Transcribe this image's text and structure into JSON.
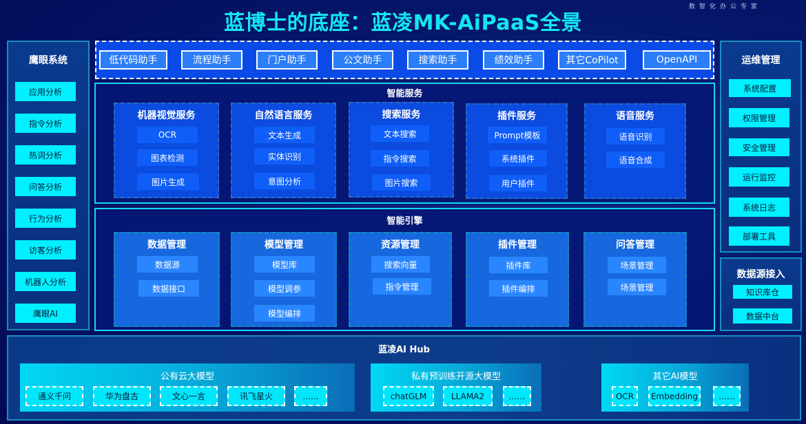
{
  "header": {
    "title": "蓝博士的底座：蓝凌MK-AiPaaS全景",
    "brand": "数智化办公专家"
  },
  "left_panel": {
    "title": "鹰眼系统",
    "items": [
      "应用分析",
      "指令分析",
      "热词分析",
      "问答分析",
      "行为分析",
      "访客分析",
      "机器人分析",
      "鹰眼AI"
    ]
  },
  "copilot_bar": {
    "items": [
      "低代码助手",
      "流程助手",
      "门户助手",
      "公文助手",
      "搜索助手",
      "绩效助手",
      "其它CoPilot",
      "OpenAPI"
    ]
  },
  "smart_services": {
    "title": "智能服务",
    "groups": [
      {
        "title": "机器视觉服务",
        "items": [
          "OCR",
          "图表检测",
          "图片生成"
        ]
      },
      {
        "title": "自然语言服务",
        "items": [
          "文本生成",
          "实体识别",
          "意图分析"
        ]
      },
      {
        "title": "搜索服务",
        "items": [
          "文本搜索",
          "指令搜索",
          "图片搜索"
        ]
      },
      {
        "title": "插件服务",
        "items": [
          "Prompt模板",
          "系统插件",
          "用户插件"
        ]
      },
      {
        "title": "语音服务",
        "items": [
          "语音识别",
          "语音合成"
        ]
      }
    ]
  },
  "smart_engine": {
    "title": "智能引擎",
    "groups": [
      {
        "title": "数据管理",
        "items": [
          "数据源",
          "数据接口"
        ]
      },
      {
        "title": "模型管理",
        "items": [
          "模型库",
          "模型调参",
          "模型编排"
        ]
      },
      {
        "title": "资源管理",
        "items": [
          "搜索向量",
          "指令管理"
        ]
      },
      {
        "title": "插件管理",
        "items": [
          "插件库",
          "插件编排"
        ]
      },
      {
        "title": "问答管理",
        "items": [
          "场景管理",
          "场景管理"
        ]
      }
    ]
  },
  "ops_panel": {
    "title": "运维管理",
    "items": [
      "系统配置",
      "权限管理",
      "安全管理",
      "运行监控",
      "系统日志",
      "部署工具"
    ]
  },
  "datasource_panel": {
    "title": "数据源接入",
    "items": [
      "知识库仓",
      "数据中台"
    ]
  },
  "ai_hub": {
    "title": "蓝凌AI Hub",
    "groups": [
      {
        "title": "公有云大模型",
        "items": [
          "通义千问",
          "华为盘古",
          "文心一言",
          "讯飞星火",
          "……"
        ]
      },
      {
        "title": "私有预训练开源大模型",
        "items": [
          "chatGLM",
          "LLAMA2",
          "……"
        ]
      },
      {
        "title": "其它AI模型",
        "items": [
          "OCR",
          "Embedding",
          "……"
        ]
      }
    ]
  },
  "colors": {
    "title": "#14e6f0",
    "accent_cyan": "#00f0ff",
    "copilot_bar": "#0a4be8",
    "background": "#05166a"
  }
}
